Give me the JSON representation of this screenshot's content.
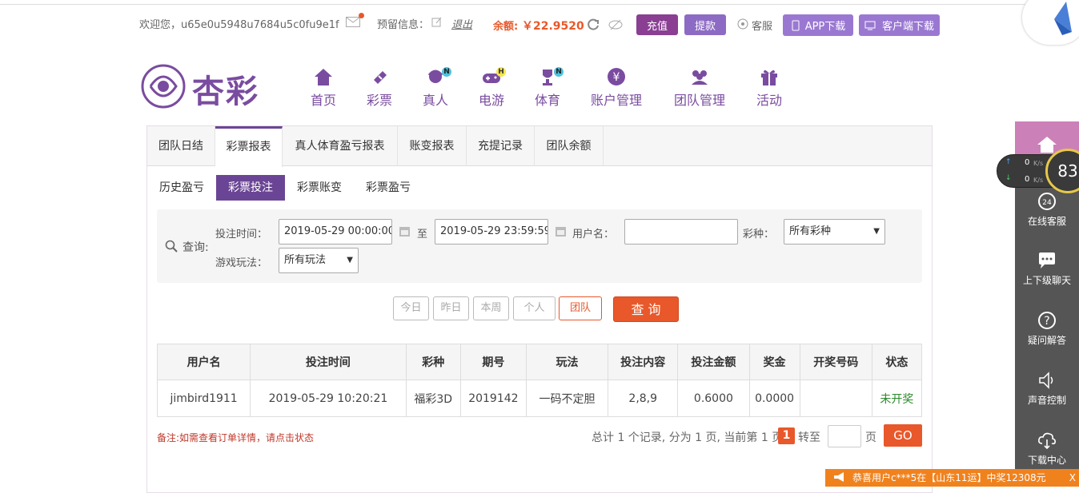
{
  "header": {
    "welcome": "欢迎您，u65e0u5948u7684u5c0fu9e1f",
    "reserved_info": "预留信息：",
    "logout": "退出",
    "balance_label": "余额:",
    "balance_value": "￥22.9520",
    "recharge": "充值",
    "withdraw": "提款",
    "service": "客服",
    "app_download": "APP下载",
    "client_download": "客户端下载"
  },
  "logo": {
    "text": "杏彩"
  },
  "nav": [
    {
      "label": "首页",
      "icon": "home-icon"
    },
    {
      "label": "彩票",
      "icon": "ticket-icon"
    },
    {
      "label": "真人",
      "icon": "dealer-icon",
      "badge": "N"
    },
    {
      "label": "电游",
      "icon": "gamepad-icon",
      "badge": "H"
    },
    {
      "label": "体育",
      "icon": "trophy-icon",
      "badge": "N"
    },
    {
      "label": "账户管理",
      "icon": "account-icon"
    },
    {
      "label": "团队管理",
      "icon": "team-icon"
    },
    {
      "label": "活动",
      "icon": "gift-icon"
    }
  ],
  "tabs": [
    "团队日结",
    "彩票报表",
    "真人体育盈亏报表",
    "账变报表",
    "充提记录",
    "团队余额"
  ],
  "subtabs": [
    "历史盈亏",
    "彩票投注",
    "彩票账变",
    "彩票盈亏"
  ],
  "search": {
    "label": "查询:",
    "time_label": "投注时间：",
    "start_time": "2019-05-29 00:00:00",
    "to": "至",
    "end_time": "2019-05-29 23:59:59",
    "username_label": "用户名：",
    "username_value": "",
    "lottery_label": "彩种：",
    "lottery_value": "所有彩种",
    "play_label": "游戏玩法：",
    "play_value": "所有玩法"
  },
  "quick": {
    "today": "今日",
    "yesterday": "昨日",
    "week": "本周",
    "personal": "个人",
    "team": "团队",
    "query": "查 询"
  },
  "table": {
    "headers": [
      "用户名",
      "投注时间",
      "彩种",
      "期号",
      "玩法",
      "投注内容",
      "投注金额",
      "奖金",
      "开奖号码",
      "状态"
    ],
    "rows": [
      [
        "jimbird1911",
        "2019-05-29 10:20:21",
        "福彩3D",
        "2019142",
        "一码不定胆",
        "2,8,9",
        "0.6000",
        "0.0000",
        "",
        "未开奖"
      ]
    ]
  },
  "footer": {
    "note": "备注:如需查看订单详情，请点击状态",
    "summary": "总计 1 个记录, 分为 1 页, 当前第 1 页",
    "current_page": "1",
    "goto": "转至",
    "page_unit": "页",
    "go": "GO"
  },
  "sidebar": {
    "items": [
      "在线客服",
      "上下级聊天",
      "疑问解答",
      "声音控制",
      "下载中心"
    ]
  },
  "widget": {
    "up": "0",
    "down": "0",
    "unit": "K/s",
    "percent": "83"
  },
  "ticker": {
    "text": "恭喜用户c***5在【山东11运】中奖12308元",
    "close": "X"
  },
  "colors": {
    "purple": "#7a4ca0",
    "orange": "#e8582a",
    "balance": "#e8582a"
  }
}
